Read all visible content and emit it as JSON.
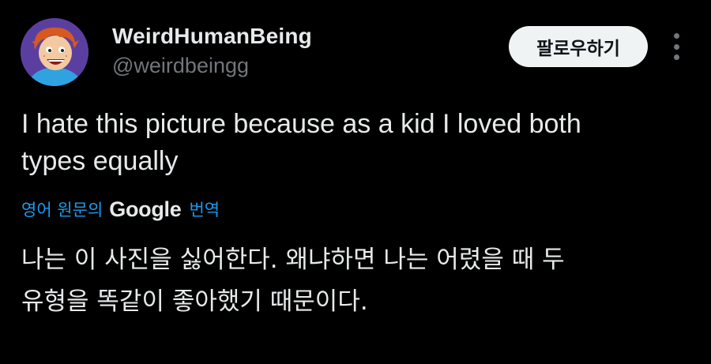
{
  "author": {
    "display_name": "WeirdHumanBeing",
    "handle": "@weirdbeingg",
    "avatar_icon": "cartoon-kid-avatar"
  },
  "actions": {
    "follow_label": "팔로우하기",
    "more_icon": "more-vertical-icon"
  },
  "tweet": {
    "text_line1": "I hate this picture because as a kid I loved both",
    "text_line2": "types equally"
  },
  "translation": {
    "prefix": "영어 원문의",
    "brand": "Google",
    "suffix": "번역",
    "line1": "나는 이 사진을 싫어한다. 왜냐하면 나는 어렸을 때 두",
    "line2": "유형을 똑같이 좋아했기 때문이다."
  },
  "colors": {
    "background": "#000000",
    "primary_text": "#e7e9ea",
    "secondary_text": "#71767b",
    "link": "#1d9bf0",
    "button_bg": "#eff3f4"
  }
}
